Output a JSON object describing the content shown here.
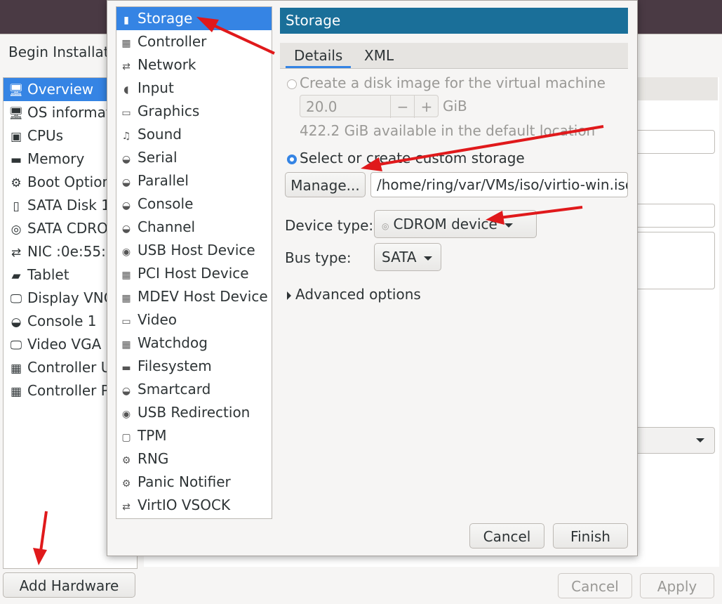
{
  "background_window": {
    "title": "Begin Installat",
    "items": [
      {
        "icon": "monitor-icon",
        "glyph": "🖥",
        "label": "Overview",
        "selected": true
      },
      {
        "icon": "monitor-icon",
        "glyph": "🖥",
        "label": "OS informat"
      },
      {
        "icon": "cpu-icon",
        "glyph": "▣",
        "label": "CPUs"
      },
      {
        "icon": "memory-icon",
        "glyph": "▬",
        "label": "Memory"
      },
      {
        "icon": "gear-icon",
        "glyph": "⚙",
        "label": "Boot Option"
      },
      {
        "icon": "disk-icon",
        "glyph": "▯",
        "label": "SATA Disk 1"
      },
      {
        "icon": "cdrom-icon",
        "glyph": "◎",
        "label": "SATA CDRO"
      },
      {
        "icon": "network-icon",
        "glyph": "⇄",
        "label": "NIC :0e:55:"
      },
      {
        "icon": "tablet-icon",
        "glyph": "▰",
        "label": "Tablet"
      },
      {
        "icon": "display-icon",
        "glyph": "🖵",
        "label": "Display VNC"
      },
      {
        "icon": "console-icon",
        "glyph": "◒",
        "label": "Console 1"
      },
      {
        "icon": "video-icon",
        "glyph": "🖵",
        "label": "Video VGA"
      },
      {
        "icon": "controller-icon",
        "glyph": "▦",
        "label": "Controller U"
      },
      {
        "icon": "controller-icon",
        "glyph": "▦",
        "label": "Controller P"
      }
    ],
    "add_hardware_label": "Add Hardware",
    "cancel_label": "Cancel",
    "apply_label": "Apply"
  },
  "dialog": {
    "hardware_list": [
      {
        "icon": "storage-icon",
        "glyph": "▮",
        "label": "Storage",
        "selected": true
      },
      {
        "icon": "controller-icon",
        "glyph": "▦",
        "label": "Controller"
      },
      {
        "icon": "network-icon",
        "glyph": "⇄",
        "label": "Network"
      },
      {
        "icon": "mouse-icon",
        "glyph": "◖",
        "label": "Input"
      },
      {
        "icon": "graphics-icon",
        "glyph": "▭",
        "label": "Graphics"
      },
      {
        "icon": "sound-icon",
        "glyph": "♫",
        "label": "Sound"
      },
      {
        "icon": "serial-icon",
        "glyph": "◒",
        "label": "Serial"
      },
      {
        "icon": "parallel-icon",
        "glyph": "◒",
        "label": "Parallel"
      },
      {
        "icon": "console-icon",
        "glyph": "◒",
        "label": "Console"
      },
      {
        "icon": "channel-icon",
        "glyph": "◒",
        "label": "Channel"
      },
      {
        "icon": "usb-icon",
        "glyph": "◉",
        "label": "USB Host Device"
      },
      {
        "icon": "pci-icon",
        "glyph": "▦",
        "label": "PCI Host Device"
      },
      {
        "icon": "mdev-icon",
        "glyph": "▦",
        "label": "MDEV Host Device"
      },
      {
        "icon": "video-icon",
        "glyph": "▭",
        "label": "Video"
      },
      {
        "icon": "watchdog-icon",
        "glyph": "▦",
        "label": "Watchdog"
      },
      {
        "icon": "folder-icon",
        "glyph": "▬",
        "label": "Filesystem"
      },
      {
        "icon": "smartcard-icon",
        "glyph": "◒",
        "label": "Smartcard"
      },
      {
        "icon": "usb-redirection-icon",
        "glyph": "◉",
        "label": "USB Redirection"
      },
      {
        "icon": "tpm-icon",
        "glyph": "▢",
        "label": "TPM"
      },
      {
        "icon": "rng-icon",
        "glyph": "⚙",
        "label": "RNG"
      },
      {
        "icon": "panic-icon",
        "glyph": "⚙",
        "label": "Panic Notifier"
      },
      {
        "icon": "vsock-icon",
        "glyph": "⇄",
        "label": "VirtIO VSOCK"
      }
    ],
    "panel_title": "Storage",
    "tabs": [
      {
        "label": "Details",
        "active": true
      },
      {
        "label": "XML",
        "active": false
      }
    ],
    "create_disk_label": "Create a disk image for the virtual machine",
    "disk_size_value": "20.0",
    "disk_size_unit": "GiB",
    "available_text": "422.2 GiB available in the default location",
    "custom_storage_label": "Select or create custom storage",
    "manage_label": "Manage...",
    "storage_path": "/home/ring/var/VMs/iso/virtio-win.iso",
    "device_type_label": "Device type:",
    "device_type_value": "CDROM device",
    "bus_type_label": "Bus type:",
    "bus_type_value": "SATA",
    "advanced_label": "Advanced options",
    "cancel_label": "Cancel",
    "finish_label": "Finish"
  },
  "colors": {
    "accent": "#3584e4",
    "title_bar": "#1a6f99",
    "annotation_arrow": "#e0191b"
  }
}
